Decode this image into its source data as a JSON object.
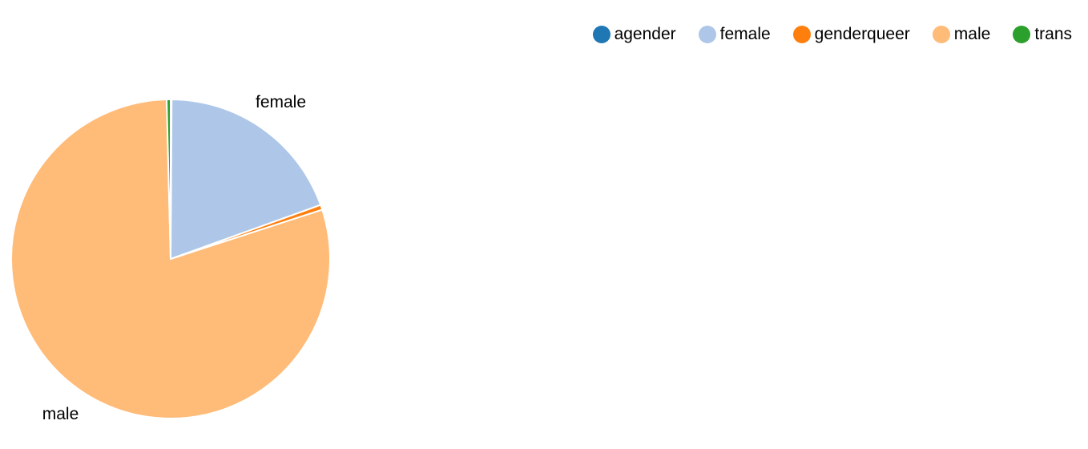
{
  "chart_data": {
    "type": "pie",
    "title": "",
    "slices": [
      {
        "label": "agender",
        "value": 0.1,
        "color": "#1f77b4",
        "show_label": false
      },
      {
        "label": "female",
        "value": 19.4,
        "color": "#aec7e8",
        "show_label": true
      },
      {
        "label": "genderqueer",
        "value": 0.5,
        "color": "#ff7f0e",
        "show_label": false
      },
      {
        "label": "male",
        "value": 79.6,
        "color": "#ffbb78",
        "show_label": true
      },
      {
        "label": "trans",
        "value": 0.4,
        "color": "#2ca02c",
        "show_label": false
      }
    ],
    "start_angle_deg": 0,
    "direction": "clockwise",
    "legend_position": "top-right",
    "legend": [
      "agender",
      "female",
      "genderqueer",
      "male",
      "trans"
    ]
  }
}
